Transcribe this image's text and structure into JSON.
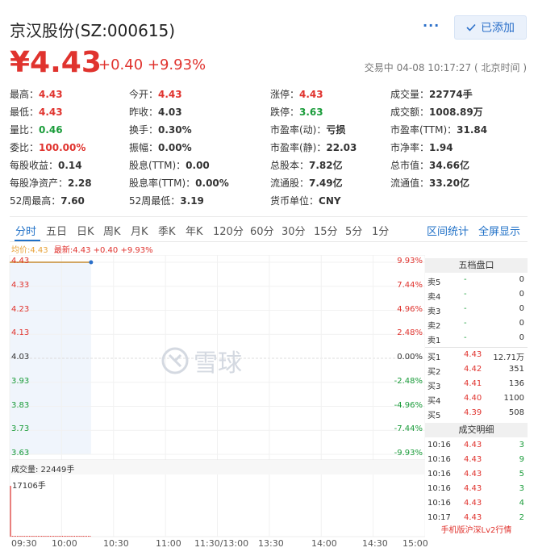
{
  "header": {
    "title": "京汉股份(SZ:000615)",
    "more_label": "···",
    "add_label": "已添加",
    "price": "¥4.43",
    "change": "+0.40 +9.93%",
    "trade_status": "交易中 04-08 10:17:27 ( 北京时间 )"
  },
  "colors": {
    "up": "#e0332e",
    "down": "#1a9c3a",
    "accent": "#1f70c7"
  },
  "stats": [
    [
      {
        "label": "最高：",
        "value": "4.43",
        "color": "red"
      },
      {
        "label": "今开：",
        "value": "4.43",
        "color": "red"
      },
      {
        "label": "涨停：",
        "value": "4.43",
        "color": "red"
      },
      {
        "label": "成交量：",
        "value": "22774手",
        "color": ""
      }
    ],
    [
      {
        "label": "最低：",
        "value": "4.43",
        "color": "red"
      },
      {
        "label": "昨收：",
        "value": "4.03",
        "color": ""
      },
      {
        "label": "跌停：",
        "value": "3.63",
        "color": "green"
      },
      {
        "label": "成交额：",
        "value": "1008.89万",
        "color": ""
      }
    ],
    [
      {
        "label": "量比：",
        "value": "0.46",
        "color": "green"
      },
      {
        "label": "换手：",
        "value": "0.30%",
        "color": ""
      },
      {
        "label": "市盈率(动)：",
        "value": "亏损",
        "color": ""
      },
      {
        "label": "市盈率(TTM)：",
        "value": "31.84",
        "color": ""
      }
    ],
    [
      {
        "label": "委比：",
        "value": "100.00%",
        "color": "red"
      },
      {
        "label": "振幅：",
        "value": "0.00%",
        "color": ""
      },
      {
        "label": "市盈率(静)：",
        "value": "22.03",
        "color": ""
      },
      {
        "label": "市净率：",
        "value": "1.94",
        "color": ""
      }
    ],
    [
      {
        "label": "每股收益：",
        "value": "0.14",
        "color": ""
      },
      {
        "label": "股息(TTM)：",
        "value": "0.00",
        "color": ""
      },
      {
        "label": "总股本：",
        "value": "7.82亿",
        "color": ""
      },
      {
        "label": "总市值：",
        "value": "34.66亿",
        "color": ""
      }
    ],
    [
      {
        "label": "每股净资产：",
        "value": "2.28",
        "color": ""
      },
      {
        "label": "股息率(TTM)：",
        "value": "0.00%",
        "color": ""
      },
      {
        "label": "流通股：",
        "value": "7.49亿",
        "color": ""
      },
      {
        "label": "流通值：",
        "value": "33.20亿",
        "color": ""
      }
    ],
    [
      {
        "label": "52周最高：",
        "value": "7.60",
        "color": ""
      },
      {
        "label": "52周最低：",
        "value": "3.19",
        "color": ""
      },
      {
        "label": "货币单位：",
        "value": "CNY",
        "color": ""
      },
      {
        "label": "",
        "value": "",
        "color": ""
      }
    ]
  ],
  "tabs": [
    "分时",
    "五日",
    "日K",
    "周K",
    "月K",
    "季K",
    "年K",
    "120分",
    "60分",
    "30分",
    "15分",
    "5分",
    "1分"
  ],
  "active_tab": 0,
  "tabs_right": [
    "区间统计",
    "全屏显示"
  ],
  "chart_info": {
    "avg": "均价:4.43",
    "latest": "最新:4.43 +0.40 +9.93%"
  },
  "watermark": "雪球",
  "chart_data": {
    "type": "line",
    "title": "",
    "y_price_ticks": [
      "4.43",
      "4.33",
      "4.23",
      "4.13",
      "4.03",
      "3.93",
      "3.83",
      "3.73",
      "3.63"
    ],
    "y_pct_ticks": [
      "9.93%",
      "7.44%",
      "4.96%",
      "2.48%",
      "0.00%",
      "-2.48%",
      "-4.96%",
      "-7.44%",
      "-9.93%"
    ],
    "ylim": [
      3.63,
      4.43
    ],
    "prev_close": 4.03,
    "x_ticks": [
      "09:30",
      "10:00",
      "10:30",
      "11:00",
      "11:30/13:00",
      "13:30",
      "14:00",
      "14:30",
      "15:00"
    ],
    "session_minutes": 240,
    "series": [
      {
        "name": "最新",
        "x_minutes": [
          0,
          47
        ],
        "values": [
          4.43,
          4.43
        ]
      },
      {
        "name": "均价",
        "x_minutes": [
          0,
          47
        ],
        "values": [
          4.43,
          4.43
        ]
      }
    ],
    "volume_label": "成交量: 22449手",
    "volume_max_label": "17106手",
    "volume_max": 17106,
    "volume_bars": [
      17106,
      120,
      90,
      150,
      80,
      110,
      60,
      140,
      95,
      70,
      130,
      85,
      60,
      100,
      75,
      90,
      55,
      120,
      65,
      80,
      110,
      70,
      95,
      60,
      85,
      75,
      100,
      65,
      90,
      80,
      70,
      60,
      85,
      95,
      55,
      75,
      65,
      80,
      70,
      60,
      90,
      55,
      75,
      65,
      85,
      70,
      60
    ]
  },
  "orderbook": {
    "title": "五档盘口",
    "asks": [
      {
        "label": "卖5",
        "price": "-",
        "vol": "0"
      },
      {
        "label": "卖4",
        "price": "-",
        "vol": "0"
      },
      {
        "label": "卖3",
        "price": "-",
        "vol": "0"
      },
      {
        "label": "卖2",
        "price": "-",
        "vol": "0"
      },
      {
        "label": "卖1",
        "price": "-",
        "vol": "0"
      }
    ],
    "bids": [
      {
        "label": "买1",
        "price": "4.43",
        "vol": "12.71万"
      },
      {
        "label": "买2",
        "price": "4.42",
        "vol": "351"
      },
      {
        "label": "买3",
        "price": "4.41",
        "vol": "136"
      },
      {
        "label": "买4",
        "price": "4.40",
        "vol": "1100"
      },
      {
        "label": "买5",
        "price": "4.39",
        "vol": "508"
      }
    ],
    "trades_title": "成交明细",
    "trades": [
      {
        "time": "10:16",
        "price": "4.43",
        "vol": "3"
      },
      {
        "time": "10:16",
        "price": "4.43",
        "vol": "9"
      },
      {
        "time": "10:16",
        "price": "4.43",
        "vol": "5"
      },
      {
        "time": "10:16",
        "price": "4.43",
        "vol": "3"
      },
      {
        "time": "10:16",
        "price": "4.43",
        "vol": "4"
      },
      {
        "time": "10:17",
        "price": "4.43",
        "vol": "2"
      }
    ],
    "l2_link": "手机版沪深Lv2行情"
  }
}
